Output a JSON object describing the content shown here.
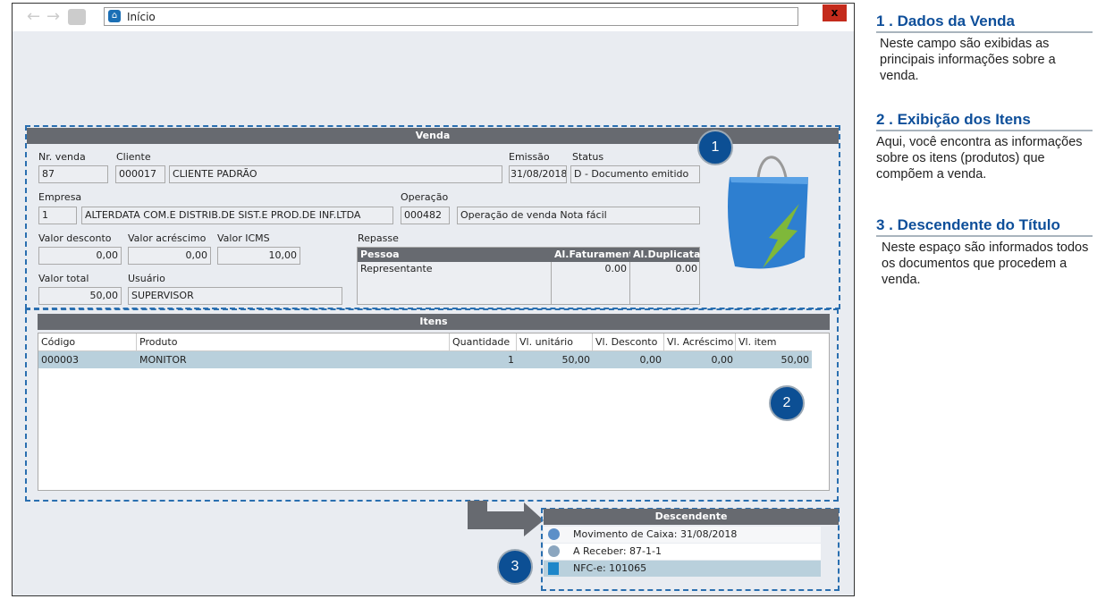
{
  "window": {
    "address": "Início",
    "close": "x"
  },
  "venda": {
    "title": "Venda",
    "nr_venda": {
      "label": "Nr. venda",
      "value": "87"
    },
    "cliente": {
      "label": "Cliente",
      "code": "000017",
      "name": "CLIENTE PADRÃO"
    },
    "emissao": {
      "label": "Emissão",
      "value": "31/08/2018"
    },
    "status": {
      "label": "Status",
      "value": "D - Documento emitido"
    },
    "empresa": {
      "label": "Empresa",
      "code": "1",
      "name": "ALTERDATA COM.E DISTRIB.DE SIST.E PROD.DE INF.LTDA"
    },
    "operacao": {
      "label": "Operação",
      "code": "000482",
      "name": "Operação de venda Nota fácil"
    },
    "valor_desconto": {
      "label": "Valor desconto",
      "value": "0,00"
    },
    "valor_acrescimo": {
      "label": "Valor acréscimo",
      "value": "0,00"
    },
    "valor_icms": {
      "label": "Valor ICMS",
      "value": "10,00"
    },
    "valor_total": {
      "label": "Valor total",
      "value": "50,00"
    },
    "usuario": {
      "label": "Usuário",
      "value": "SUPERVISOR"
    },
    "repasse": {
      "label": "Repasse",
      "columns": [
        "Pessoa",
        "Al.Faturamento",
        "Al.Duplicata"
      ],
      "rows": [
        [
          "Representante",
          "0.00",
          "0.00"
        ]
      ]
    }
  },
  "itens": {
    "title": "Itens",
    "columns": [
      "Código",
      "Produto",
      "Quantidade",
      "Vl. unitário",
      "Vl. Desconto",
      "Vl. Acréscimo",
      "Vl. item"
    ],
    "rows": [
      [
        "000003",
        "MONITOR",
        "1",
        "50,00",
        "0,00",
        "0,00",
        "50,00"
      ]
    ]
  },
  "descendente": {
    "title": "Descendente",
    "items": [
      {
        "icon": "money-refresh-icon",
        "label": "Movimento de Caixa: 31/08/2018"
      },
      {
        "icon": "money-refresh-icon",
        "label": "A Receber: 87-1-1"
      },
      {
        "icon": "document-icon",
        "label": "NFC-e: 101065"
      }
    ]
  },
  "badges": [
    "1",
    "2",
    "3"
  ],
  "side": [
    {
      "title": "1 . Dados da Venda",
      "text": "Neste campo são exibidas as principais informações sobre a venda."
    },
    {
      "title": "2 . Exibição dos Itens",
      "text": "Aqui, você encontra as informações sobre os itens (produtos) que compõem a venda."
    },
    {
      "title": "3 . Descendente do Título",
      "text": "Neste espaço são informados todos os documentos que procedem a venda."
    }
  ]
}
